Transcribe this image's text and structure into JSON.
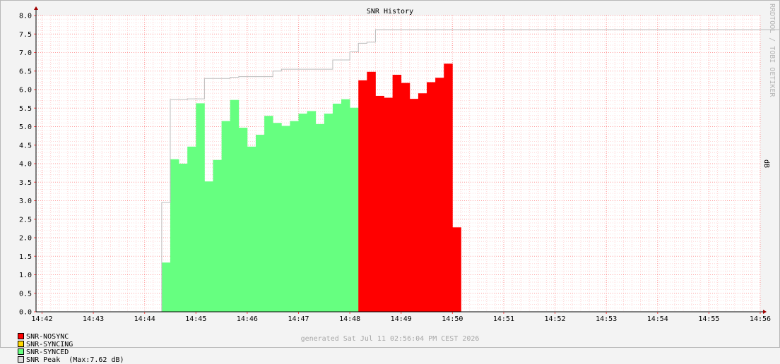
{
  "chart_data": {
    "type": "area",
    "title": "SNR History",
    "ylabel": "dB",
    "ylim": [
      0,
      8
    ],
    "yticks": [
      "0.0",
      "0.5",
      "1.0",
      "1.5",
      "2.0",
      "2.5",
      "3.0",
      "3.5",
      "4.0",
      "4.5",
      "5.0",
      "5.5",
      "6.0",
      "6.5",
      "7.0",
      "7.5",
      "8.0"
    ],
    "xlim": [
      "14:41:53",
      "14:56:00"
    ],
    "xticks": [
      "14:42",
      "14:43",
      "14:44",
      "14:45",
      "14:46",
      "14:47",
      "14:48",
      "14:49",
      "14:50",
      "14:51",
      "14:52",
      "14:53",
      "14:54",
      "14:55",
      "14:56"
    ],
    "grid": true,
    "step_seconds": 10,
    "series": [
      {
        "name": "SNR-NOSYNC",
        "color": "#ff0000",
        "start": "14:48:10",
        "values": [
          6.25,
          6.48,
          5.83,
          5.78,
          6.4,
          6.18,
          5.75,
          5.9,
          6.2,
          6.32,
          6.7,
          2.28
        ]
      },
      {
        "name": "SNR-SYNCING",
        "color": "#ffd700",
        "start": "",
        "values": []
      },
      {
        "name": "SNR-SYNCED",
        "color": "#66ff80",
        "start": "14:44:20",
        "values": [
          1.33,
          4.12,
          4.0,
          4.46,
          5.63,
          3.52,
          4.1,
          5.15,
          5.72,
          4.97,
          4.46,
          4.78,
          5.29,
          5.1,
          5.02,
          5.15,
          5.35,
          5.42,
          5.07,
          5.35,
          5.62,
          5.74,
          5.51
        ]
      },
      {
        "name": "SNR Peak",
        "color": "#bdbdbd",
        "start": "14:44:20",
        "values": [
          2.95,
          5.73,
          5.73,
          5.75,
          5.75,
          6.3,
          6.3,
          6.3,
          6.33,
          6.35,
          6.35,
          6.35,
          6.35,
          6.5,
          6.55,
          6.55,
          6.55,
          6.55,
          6.55,
          6.55,
          6.8,
          6.8,
          7.02,
          7.25,
          7.28,
          7.62,
          7.62,
          7.62,
          7.62,
          7.62,
          7.62,
          7.62,
          7.62,
          7.62,
          7.62,
          7.62,
          7.62,
          7.62,
          7.62,
          7.62,
          7.62,
          7.62,
          7.62,
          7.62,
          7.62,
          7.62,
          7.62,
          7.62,
          7.62,
          7.62,
          7.62,
          7.62,
          7.62,
          7.62,
          7.62,
          7.62,
          7.62,
          7.62,
          7.62,
          7.62,
          7.62,
          7.62,
          7.62,
          7.62,
          7.62,
          7.62,
          7.62,
          7.62,
          7.62,
          7.62,
          7.62,
          7.62,
          7.62,
          7.62,
          7.62
        ]
      }
    ],
    "legend": [
      "SNR-NOSYNC",
      "SNR-SYNCING",
      "SNR-SYNCED",
      "SNR Peak"
    ],
    "peak_note": "(Max:7.62 dB)"
  },
  "footer": "generated Sat Jul 11 02:56:04 PM CEST 2026",
  "watermark": "RRDTOOL / TOBI OETIKER"
}
